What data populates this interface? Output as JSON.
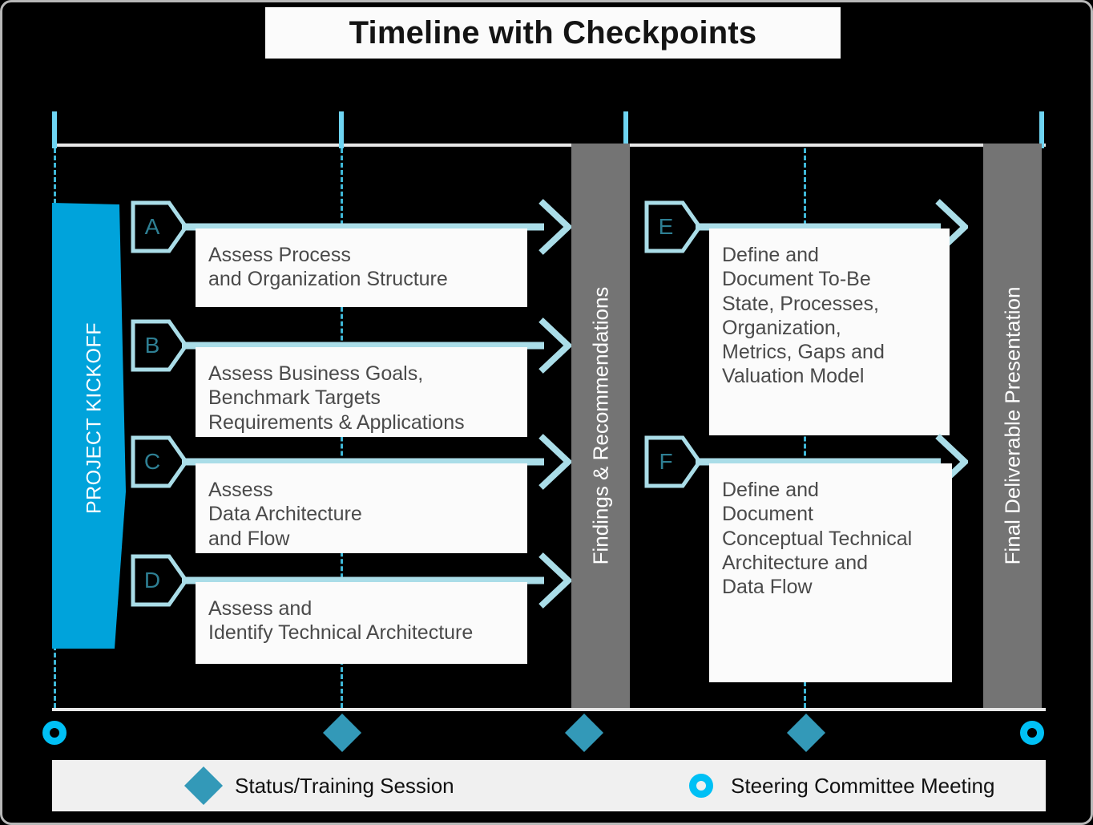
{
  "title": "Timeline with Checkpoints",
  "kickoff": {
    "label": "PROJECT KICKOFF"
  },
  "phases": [
    {
      "id": "findings",
      "label": "Findings & Recommendations"
    },
    {
      "id": "final",
      "label": "Final Deliverable Presentation"
    }
  ],
  "workstreams": [
    {
      "tag": "A",
      "text": "Assess Process\nand Organization Structure"
    },
    {
      "tag": "B",
      "text": "Assess Business Goals,\nBenchmark Targets\nRequirements & Applications"
    },
    {
      "tag": "C",
      "text": "Assess\nData Architecture\nand Flow"
    },
    {
      "tag": "D",
      "text": "Assess and\nIdentify Technical Architecture"
    },
    {
      "tag": "E",
      "text": "Define and\nDocument To-Be\nState, Processes,\nOrganization,\nMetrics, Gaps and\nValuation Model"
    },
    {
      "tag": "F",
      "text": "Define and\nDocument\nConceptual Technical\nArchitecture and\nData Flow"
    }
  ],
  "legend": [
    {
      "marker": "diamond-icon",
      "label": "Status/Training Session"
    },
    {
      "marker": "ring-icon",
      "label": "Steering Committee Meeting"
    }
  ],
  "milestones": [
    {
      "type": "ring-icon"
    },
    {
      "type": "diamond-icon"
    },
    {
      "type": "diamond-icon"
    },
    {
      "type": "diamond-icon"
    },
    {
      "type": "ring-icon"
    }
  ],
  "colors": {
    "accent_blue": "#00a3db",
    "arrow_cyan": "#aadde8",
    "tag_text": "#2e7f93",
    "bar_gray": "#747474",
    "diamond": "#3399b8",
    "ring": "#00c0f5",
    "box_bg": "#fbfbfb",
    "body_text": "#4a4a4a",
    "background": "#000000"
  }
}
